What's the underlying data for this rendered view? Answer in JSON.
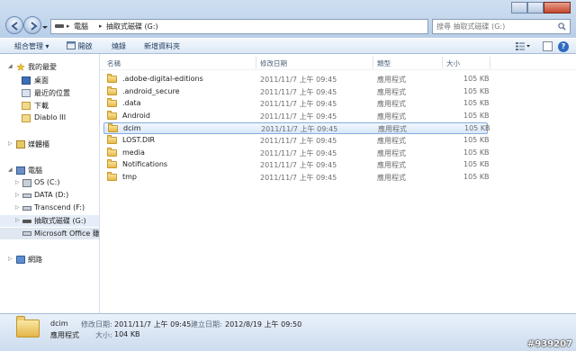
{
  "address_bar": {
    "crumbs": [
      "電腦",
      "抽取式磁碟 (G:)"
    ],
    "search_placeholder": "搜尋 抽取式磁碟 (G:)"
  },
  "toolbar": {
    "organize": "組合管理 ▾",
    "open": "開啟",
    "burn": "燒錄",
    "new_folder": "新增資料夾",
    "help": "?"
  },
  "navpane": {
    "favorites": "我的最愛",
    "desktop": "桌面",
    "recent": "最近的位置",
    "downloads": "下載",
    "diablo": "Diablo III",
    "libraries": "媒體櫃",
    "computer": "電腦",
    "os_c": "OS (C:)",
    "data_d": "DATA (D:)",
    "transcend_f": "Transcend (F:)",
    "removable_g": "抽取式磁碟 (G:)",
    "office": "Microsoft Office 雖",
    "network": "網路"
  },
  "columns": {
    "name": "名稱",
    "modified": "修改日期",
    "type": "類型",
    "size": "大小"
  },
  "files": [
    {
      "name": ".adobe-digital-editions",
      "date": "2011/11/7 上午 09:45",
      "type": "應用程式",
      "size": "105 KB"
    },
    {
      "name": ".android_secure",
      "date": "2011/11/7 上午 09:45",
      "type": "應用程式",
      "size": "105 KB"
    },
    {
      "name": ".data",
      "date": "2011/11/7 上午 09:45",
      "type": "應用程式",
      "size": "105 KB"
    },
    {
      "name": "Android",
      "date": "2011/11/7 上午 09:45",
      "type": "應用程式",
      "size": "105 KB"
    },
    {
      "name": "dcim",
      "date": "2011/11/7 上午 09:45",
      "type": "應用程式",
      "size": "105 KB"
    },
    {
      "name": "LOST.DIR",
      "date": "2011/11/7 上午 09:45",
      "type": "應用程式",
      "size": "105 KB"
    },
    {
      "name": "media",
      "date": "2011/11/7 上午 09:45",
      "type": "應用程式",
      "size": "105 KB"
    },
    {
      "name": "Notifications",
      "date": "2011/11/7 上午 09:45",
      "type": "應用程式",
      "size": "105 KB"
    },
    {
      "name": "tmp",
      "date": "2011/11/7 上午 09:45",
      "type": "應用程式",
      "size": "105 KB"
    }
  ],
  "selected_file": "dcim",
  "details": {
    "name": "dcim",
    "type": "應用程式",
    "modified_label": "修改日期:",
    "modified_value": "2011/11/7 上午 09:45",
    "created_label": "建立日期:",
    "created_value": "2012/8/19 上午 09:50",
    "size_label": "大小:",
    "size_value": "104 KB"
  },
  "watermark": "#939207"
}
